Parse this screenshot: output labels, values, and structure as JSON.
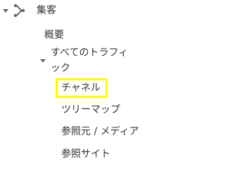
{
  "section": {
    "title": "集客",
    "icon": "acquisition-branch-icon"
  },
  "nav": {
    "overview": "概要",
    "all_traffic": {
      "label_line1": "すべてのトラフィ",
      "label_line2": "ック"
    },
    "children": [
      {
        "label": "チャネル",
        "highlighted": true
      },
      {
        "label": "ツリーマップ"
      },
      {
        "label": "参照元 / メディア"
      },
      {
        "label": "参照サイト"
      }
    ]
  },
  "colors": {
    "highlight_border": "#ffff00",
    "text": "#333333",
    "icon": "#666666"
  }
}
